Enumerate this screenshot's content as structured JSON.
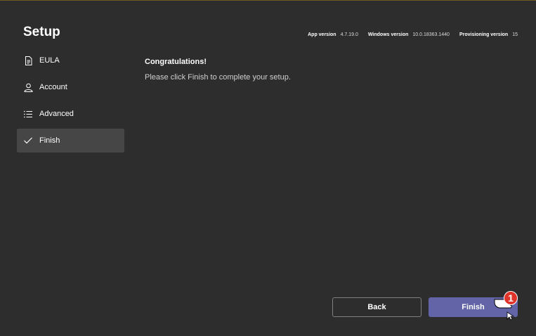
{
  "window": {
    "title": "Setup"
  },
  "versions": [
    {
      "label": "App version",
      "value": "4.7.19.0"
    },
    {
      "label": "Windows version",
      "value": "10.0.18363.1440"
    },
    {
      "label": "Provisioning version",
      "value": "15"
    }
  ],
  "sidebar": {
    "items": [
      {
        "label": "EULA",
        "icon": "document-icon",
        "active": false
      },
      {
        "label": "Account",
        "icon": "person-icon",
        "active": false
      },
      {
        "label": "Advanced",
        "icon": "list-icon",
        "active": false
      },
      {
        "label": "Finish",
        "icon": "checkmark-icon",
        "active": true
      }
    ]
  },
  "content": {
    "heading": "Congratulations!",
    "message": "Please click Finish to complete your setup."
  },
  "buttons": {
    "back_label": "Back",
    "finish_label": "Finish"
  },
  "annotation": {
    "step_number": "1"
  },
  "colors": {
    "background": "#2d2d2d",
    "active_item": "#464646",
    "primary": "#6264a7",
    "badge": "#e0342b"
  }
}
